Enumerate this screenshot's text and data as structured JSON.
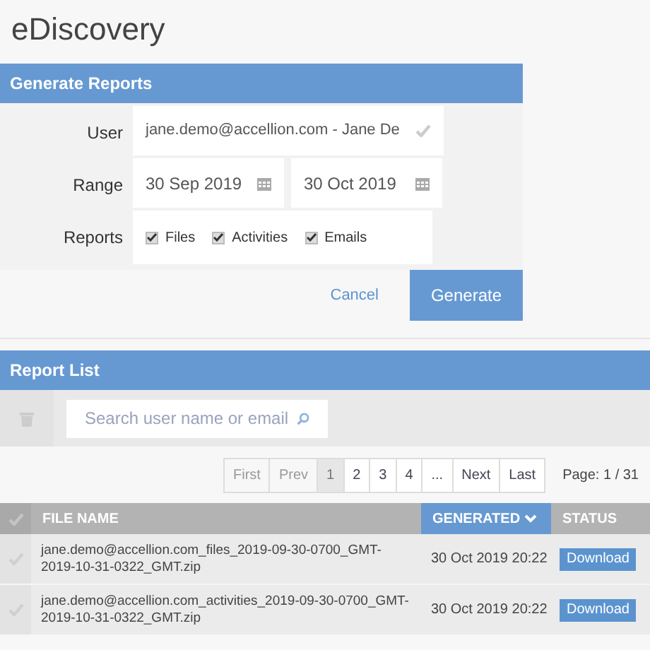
{
  "page_title": "eDiscovery",
  "generate_panel": {
    "title": "Generate Reports",
    "user": {
      "label": "User",
      "value": "jane.demo@accellion.com - Jane De",
      "verified": true
    },
    "range": {
      "label": "Range",
      "from": "30 Sep 2019",
      "to": "30 Oct 2019"
    },
    "reports": {
      "label": "Reports",
      "options": [
        {
          "label": "Files",
          "checked": true
        },
        {
          "label": "Activities",
          "checked": true
        },
        {
          "label": "Emails",
          "checked": true
        }
      ]
    },
    "buttons": [
      {
        "label": "Cancel",
        "kind": "link"
      },
      {
        "label": "Generate",
        "kind": "primary"
      }
    ]
  },
  "report_list": {
    "title": "Report List",
    "search": {
      "placeholder": "Search user name or email"
    },
    "pagination": {
      "pages": [
        {
          "label": "First",
          "disabled": true,
          "selected": false
        },
        {
          "label": "Prev",
          "disabled": true,
          "selected": false
        },
        {
          "label": "1",
          "disabled": false,
          "selected": true
        },
        {
          "label": "2",
          "disabled": false,
          "selected": false
        },
        {
          "label": "3",
          "disabled": false,
          "selected": false
        },
        {
          "label": "4",
          "disabled": false,
          "selected": false
        },
        {
          "label": "...",
          "disabled": false,
          "selected": false
        },
        {
          "label": "Next",
          "disabled": false,
          "selected": false
        },
        {
          "label": "Last",
          "disabled": false,
          "selected": false
        }
      ],
      "page_info": "Page: 1 / 31"
    },
    "table": {
      "columns": [
        {
          "label": "FILE NAME",
          "sorted": false
        },
        {
          "label": "GENERATED",
          "sorted": true
        },
        {
          "label": "STATUS",
          "sorted": false
        }
      ],
      "rows": [
        {
          "selected": false,
          "file_name": "jane.demo@accellion.com_files_2019-09-30-0700_GMT-2019-10-31-0322_GMT.zip",
          "generated": "30 Oct 2019 20:22",
          "action": "Download"
        },
        {
          "selected": false,
          "file_name": "jane.demo@accellion.com_activities_2019-09-30-0700_GMT-2019-10-31-0322_GMT.zip",
          "generated": "30 Oct 2019 20:22",
          "action": "Download"
        }
      ]
    }
  }
}
